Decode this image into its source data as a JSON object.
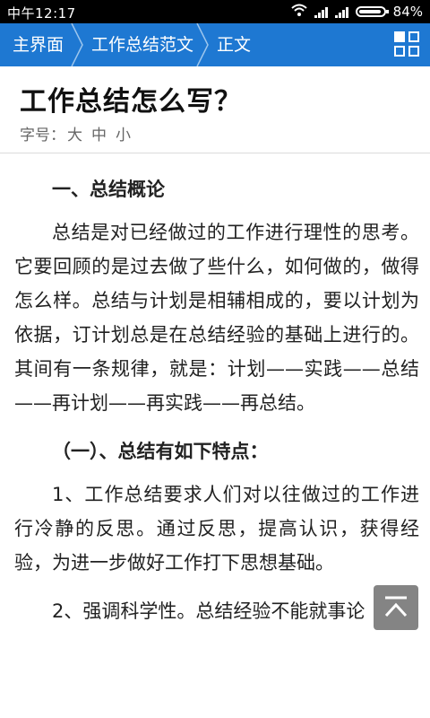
{
  "status": {
    "time": "中午12:17",
    "battery": "84%"
  },
  "nav": {
    "crumbs": [
      "主界面",
      "工作总结范文",
      "正文"
    ]
  },
  "article": {
    "title": "工作总结怎么写？",
    "font_size_label": "字号：",
    "font_sizes": [
      "大",
      "中",
      "小"
    ],
    "paragraphs": [
      "一、总结概论",
      "总结是对已经做过的工作进行理性的思考。它要回顾的是过去做了些什么，如何做的，做得怎么样。总结与计划是相辅相成的，要以计划为依据，订计划总是在总结经验的基础上进行的。其间有一条规律，就是：计划——实践——总结——再计划——再实践——再总结。",
      "（一）、总结有如下特点：",
      "1、工作总结要求人们对以往做过的工作进行冷静的反思。通过反思，提高认识，获得经验，为进一步做好工作打下思想基础。",
      "2、强调科学性。总结经验不能就事论"
    ]
  },
  "colors": {
    "navbar": "#1e78d2",
    "statusbar": "#000000"
  }
}
